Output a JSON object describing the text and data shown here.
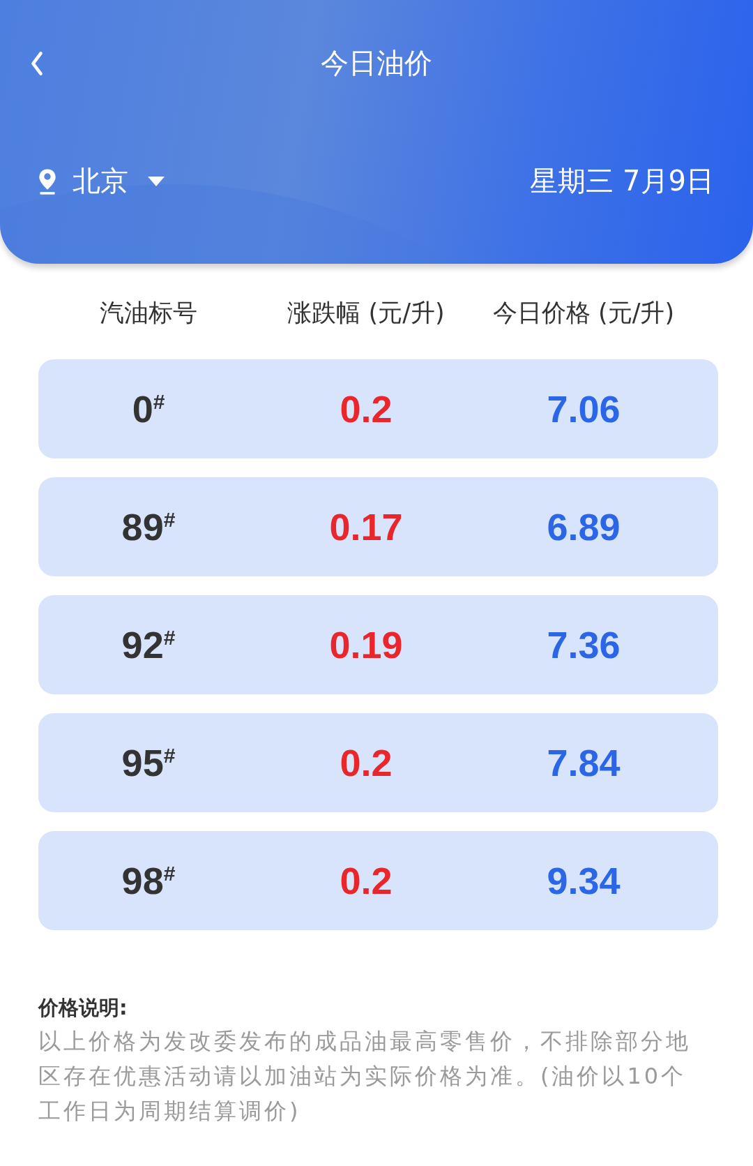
{
  "header": {
    "title": "今日油价",
    "city": "北京",
    "date": "星期三 7月9日"
  },
  "table": {
    "columns": [
      "汽油标号",
      "涨跌幅 (元/升)",
      "今日价格 (元/升)"
    ],
    "rows": [
      {
        "grade": "0$^{#}$",
        "change": "0.2",
        "price": "7.06"
      },
      {
        "grade": "89$^{#}$",
        "change": "0.17",
        "price": "6.89"
      },
      {
        "grade": "92$^{#}$",
        "change": "0.19",
        "price": "7.36"
      },
      {
        "grade": "95$^{#}$",
        "change": "0.2",
        "price": "7.84"
      },
      {
        "grade": "98$^{#}$",
        "change": "0.2",
        "price": "9.34"
      }
    ]
  },
  "note": {
    "title": "价格说明:",
    "text": "以上价格为发改委发布的成品油最高零售价，不排除部分地区存在优惠活动请以加油站为实际价格为准。(油价以10个工作日为周期结算调价)"
  }
}
